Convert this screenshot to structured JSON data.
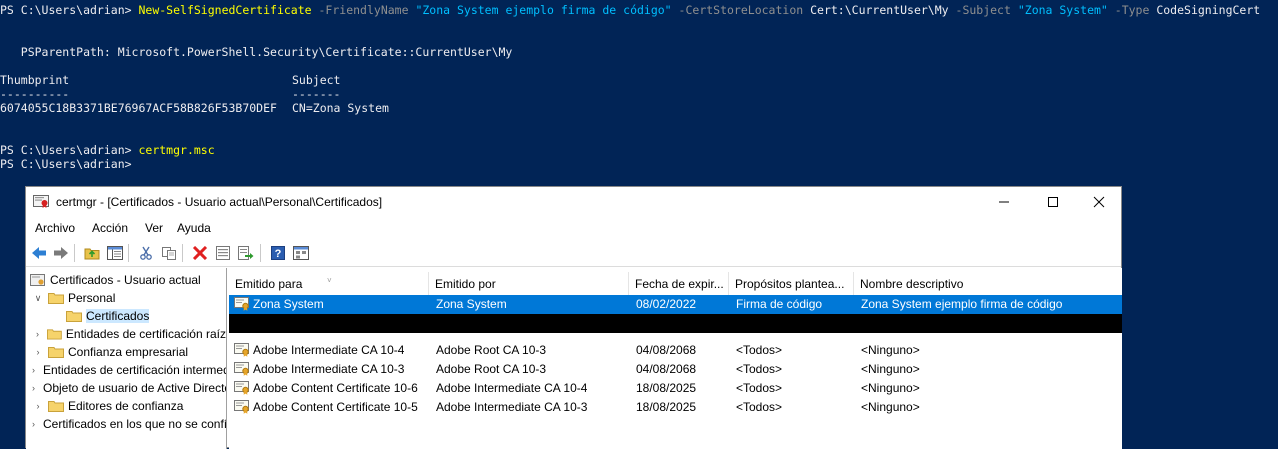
{
  "terminal": {
    "line1": {
      "prompt": "PS C:\\Users\\adrian> ",
      "cmdlet": "New-SelfSignedCertificate",
      "p1": " -FriendlyName ",
      "v1": "\"Zona System ejemplo firma de código\"",
      "p2": " -CertStoreLocation ",
      "v2": "Cert:\\CurrentUser\\My",
      "p3": " -Subject ",
      "v3": "\"Zona System\"",
      "p4": " -Type ",
      "v4": "CodeSigningCert"
    },
    "parent_path": "   PSParentPath: Microsoft.PowerShell.Security\\Certificate::CurrentUser\\My",
    "header_thumb": "Thumbprint",
    "header_subject": "Subject",
    "dash_thumb": "----------",
    "dash_subject": "-------",
    "thumb_value": "6074055C18B3371BE76967ACF58B826F53B70DEF",
    "subject_value": "CN=Zona System",
    "line_cmd2_prompt": "PS C:\\Users\\adrian> ",
    "line_cmd2": "certmgr.msc",
    "line_last": "PS C:\\Users\\adrian>"
  },
  "window": {
    "title": "certmgr - [Certificados - Usuario actual\\Personal\\Certificados]",
    "menu": [
      "Archivo",
      "Acción",
      "Ver",
      "Ayuda"
    ]
  },
  "tree": {
    "root": "Certificados - Usuario actual",
    "items": [
      {
        "label": "Personal",
        "expanded": true
      },
      {
        "label": "Certificados",
        "selected": true
      },
      {
        "label": "Entidades de certificación raíz"
      },
      {
        "label": "Confianza empresarial"
      },
      {
        "label": "Entidades de certificación intermedias"
      },
      {
        "label": "Objeto de usuario de Active Directory"
      },
      {
        "label": "Editores de confianza"
      },
      {
        "label": "Certificados en los que no se confía"
      }
    ]
  },
  "list": {
    "columns": [
      "Emitido para",
      "Emitido por",
      "Fecha de expir...",
      "Propósitos plantea...",
      "Nombre descriptivo"
    ],
    "rows": [
      {
        "issued_to": "Zona System",
        "issued_by": "Zona System",
        "expires": "08/02/2022",
        "purposes": "Firma de código",
        "friendly": "Zona System ejemplo firma de código"
      },
      {
        "issued_to": "",
        "issued_by": "",
        "expires": "",
        "purposes": "",
        "friendly": ""
      },
      {
        "issued_to": "Adobe Intermediate CA 10-4",
        "issued_by": "Adobe Root CA 10-3",
        "expires": "04/08/2068",
        "purposes": "<Todos>",
        "friendly": "<Ninguno>"
      },
      {
        "issued_to": "Adobe Intermediate CA 10-3",
        "issued_by": "Adobe Root CA 10-3",
        "expires": "04/08/2068",
        "purposes": "<Todos>",
        "friendly": "<Ninguno>"
      },
      {
        "issued_to": "Adobe Content Certificate 10-6",
        "issued_by": "Adobe Intermediate CA 10-4",
        "expires": "18/08/2025",
        "purposes": "<Todos>",
        "friendly": "<Ninguno>"
      },
      {
        "issued_to": "Adobe Content Certificate 10-5",
        "issued_by": "Adobe Intermediate CA 10-3",
        "expires": "18/08/2025",
        "purposes": "<Todos>",
        "friendly": "<Ninguno>"
      }
    ]
  },
  "colors": {
    "terminal_bg": "#012456",
    "cmdlet": "#ffff00",
    "parameter": "#8f8f8f",
    "string": "#00bfff",
    "selection": "#0078d7"
  },
  "icons": [
    "back-icon",
    "forward-icon",
    "up-folder-icon",
    "show-hide-tree-icon",
    "cut-icon",
    "copy-icon",
    "delete-icon",
    "properties-icon",
    "export-list-icon",
    "help-icon",
    "view-icon"
  ]
}
